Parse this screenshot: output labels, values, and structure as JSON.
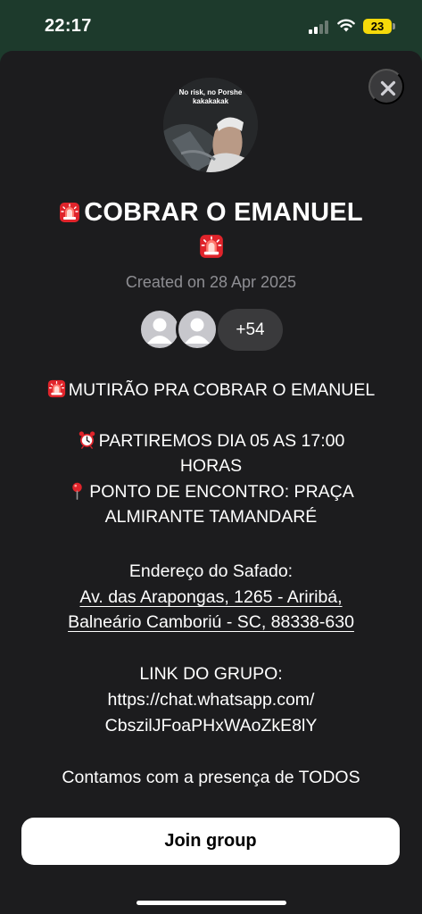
{
  "status_bar": {
    "time": "22:17",
    "battery_level": "23",
    "icons": [
      "signal-icon",
      "wifi-icon",
      "battery-icon"
    ]
  },
  "group": {
    "avatar_caption": "No risk, no Porshe kakakakak",
    "title_line1": "COBRAR O EMANUEL",
    "created": "Created on 28 Apr 2025",
    "member_count": "+54",
    "description": [
      {
        "key": "l1",
        "text": "MUTIRÃO PRA COBRAR O EMANUEL",
        "icon": "siren-icon"
      },
      {
        "key": "l2",
        "text": "PARTIREMOS DIA 05 AS 17:00",
        "icon": "alarm-clock-icon"
      },
      {
        "key": "l3",
        "text": "HORAS"
      },
      {
        "key": "l4",
        "text": "PONTO DE ENCONTRO: PRAÇA",
        "icon": "pin-icon"
      },
      {
        "key": "l5",
        "text": "ALMIRANTE TAMANDARÉ"
      },
      {
        "key": "l6",
        "text": "Endereço do Safado:"
      },
      {
        "key": "l7",
        "text": "Av. das Arapongas, 1265 - Ariribá,"
      },
      {
        "key": "l8",
        "text": "Balneário Camboriú - SC, 88338-630"
      },
      {
        "key": "l9",
        "text": "LINK DO GRUPO:"
      },
      {
        "key": "l10",
        "text": "https://chat.whatsapp.com/"
      },
      {
        "key": "l11",
        "text": "CbszilJFoaPHxWAoZkE8lY"
      },
      {
        "key": "l12",
        "text": "Contamos com a presença de TODOS"
      }
    ]
  },
  "actions": {
    "join_label": "Join group",
    "close_icon": "close-icon"
  },
  "colors": {
    "sheet_background": "#1c1c1e",
    "backdrop": "#1d3a2c",
    "secondary_text": "#8e8e93",
    "button_background": "#ffffff",
    "siren_red": "#e0242b"
  }
}
